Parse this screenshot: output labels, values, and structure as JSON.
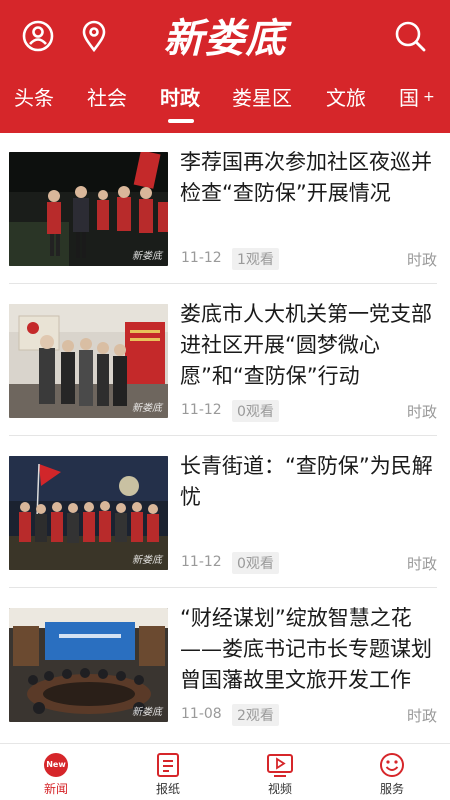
{
  "header": {
    "logo": "新娄底",
    "icons": [
      "user-icon",
      "location-icon",
      "search-icon"
    ],
    "accent_color": "#d6262a"
  },
  "tabs": [
    {
      "label": "头条",
      "active": false
    },
    {
      "label": "社会",
      "active": false
    },
    {
      "label": "时政",
      "active": true
    },
    {
      "label": "娄星区",
      "active": false
    },
    {
      "label": "文旅",
      "active": false
    },
    {
      "label": "国",
      "active": false
    }
  ],
  "tab_more_symbol": "+",
  "articles": [
    {
      "title": "李荐国再次参加社区夜巡并检查“查防保”开展情况",
      "date": "11-12",
      "views": "1观看",
      "category": "时政"
    },
    {
      "title": "娄底市人大机关第一党支部进社区开展“圆梦微心愿”和“查防保”行动",
      "date": "11-12",
      "views": "0观看",
      "category": "时政"
    },
    {
      "title": "长青街道：“查防保”为民解忧",
      "date": "11-12",
      "views": "0观看",
      "category": "时政"
    },
    {
      "title": "“财经谋划”绽放智慧之花——娄底书记市长专题谋划曾国藩故里文旅开发工作",
      "date": "11-08",
      "views": "2观看",
      "category": "时政"
    }
  ],
  "bottom_nav": [
    {
      "label": "新闻",
      "icon": "news-icon",
      "badge": "New",
      "active": true
    },
    {
      "label": "报纸",
      "icon": "newspaper-icon",
      "active": false
    },
    {
      "label": "视频",
      "icon": "video-icon",
      "active": false
    },
    {
      "label": "服务",
      "icon": "service-icon",
      "active": false
    }
  ]
}
